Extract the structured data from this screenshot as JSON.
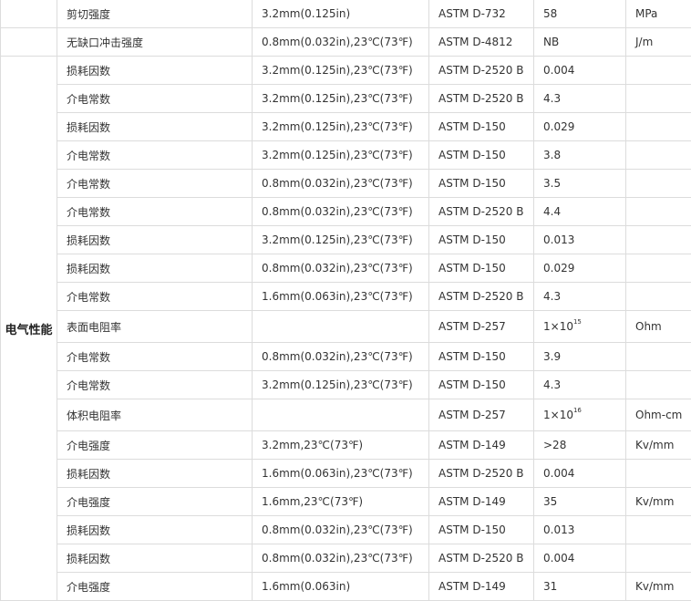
{
  "table": {
    "category": "电气性能",
    "rows": [
      {
        "property": "剪切强度",
        "condition": "3.2mm(0.125in)",
        "method": "ASTM D-732",
        "value": "58",
        "unit": "MPa"
      },
      {
        "property": "无缺口冲击强度",
        "condition": "0.8mm(0.032in),23℃(73℉)",
        "method": "ASTM D-4812",
        "value": "NB",
        "unit": "J/m"
      },
      {
        "property": "损耗因数",
        "condition": "3.2mm(0.125in),23℃(73℉)",
        "method": "ASTM D-2520 B",
        "value": "0.004",
        "unit": ""
      },
      {
        "property": "介电常数",
        "condition": "3.2mm(0.125in),23℃(73℉)",
        "method": "ASTM D-2520 B",
        "value": "4.3",
        "unit": ""
      },
      {
        "property": "损耗因数",
        "condition": "3.2mm(0.125in),23℃(73℉)",
        "method": "ASTM D-150",
        "value": "0.029",
        "unit": ""
      },
      {
        "property": "介电常数",
        "condition": "3.2mm(0.125in),23℃(73℉)",
        "method": "ASTM D-150",
        "value": "3.8",
        "unit": ""
      },
      {
        "property": "介电常数",
        "condition": "0.8mm(0.032in),23℃(73℉)",
        "method": "ASTM D-150",
        "value": "3.5",
        "unit": ""
      },
      {
        "property": "介电常数",
        "condition": "0.8mm(0.032in),23℃(73℉)",
        "method": "ASTM D-2520 B",
        "value": "4.4",
        "unit": ""
      },
      {
        "property": "损耗因数",
        "condition": "3.2mm(0.125in),23℃(73℉)",
        "method": "ASTM D-150",
        "value": "0.013",
        "unit": ""
      },
      {
        "property": "损耗因数",
        "condition": "0.8mm(0.032in),23℃(73℉)",
        "method": "ASTM D-150",
        "value": "0.029",
        "unit": ""
      },
      {
        "property": "介电常数",
        "condition": "1.6mm(0.063in),23℃(73℉)",
        "method": "ASTM D-2520 B",
        "value": "4.3",
        "unit": ""
      },
      {
        "property": "表面电阻率",
        "condition": "",
        "method": "ASTM D-257",
        "value_base": "1×10",
        "value_exp": "15",
        "unit": "Ohm"
      },
      {
        "property": "介电常数",
        "condition": "0.8mm(0.032in),23℃(73℉)",
        "method": "ASTM D-150",
        "value": "3.9",
        "unit": ""
      },
      {
        "property": "介电常数",
        "condition": "3.2mm(0.125in),23℃(73℉)",
        "method": "ASTM D-150",
        "value": "4.3",
        "unit": ""
      },
      {
        "property": "体积电阻率",
        "condition": "",
        "method": "ASTM D-257",
        "value_base": "1×10",
        "value_exp": "16",
        "unit": "Ohm-cm"
      },
      {
        "property": "介电强度",
        "condition": "3.2mm,23℃(73℉)",
        "method": "ASTM D-149",
        "value": ">28",
        "unit": "Kv/mm"
      },
      {
        "property": "损耗因数",
        "condition": "1.6mm(0.063in),23℃(73℉)",
        "method": "ASTM D-2520 B",
        "value": "0.004",
        "unit": ""
      },
      {
        "property": "介电强度",
        "condition": "1.6mm,23℃(73℉)",
        "method": "ASTM D-149",
        "value": "35",
        "unit": "Kv/mm"
      },
      {
        "property": "损耗因数",
        "condition": "0.8mm(0.032in),23℃(73℉)",
        "method": "ASTM D-150",
        "value": "0.013",
        "unit": ""
      },
      {
        "property": "损耗因数",
        "condition": "0.8mm(0.032in),23℃(73℉)",
        "method": "ASTM D-2520 B",
        "value": "0.004",
        "unit": ""
      },
      {
        "property": "介电强度",
        "condition": "1.6mm(0.063in)",
        "method": "ASTM D-149",
        "value": "31",
        "unit": "Kv/mm"
      }
    ]
  }
}
